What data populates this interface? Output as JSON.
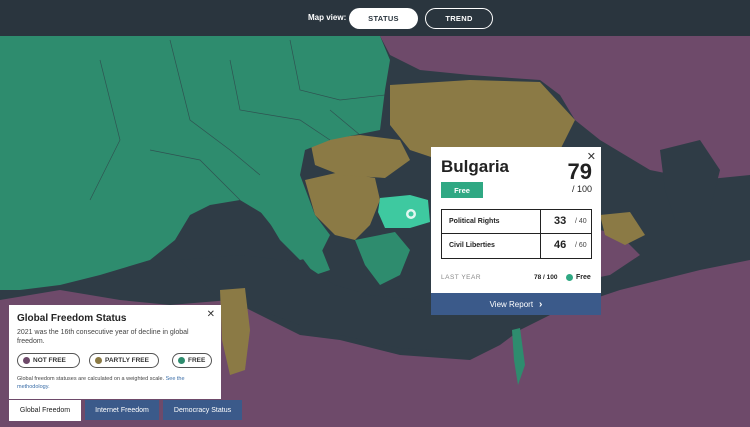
{
  "colors": {
    "free": "#2e8c6e",
    "free_highlight": "#3ec9a0",
    "partly_free": "#8b7a45",
    "not_free": "#6e4a6a",
    "water": "#2f3c46",
    "accent_blue": "#3b5a8a"
  },
  "topbar": {
    "map_view_label": "Map view:",
    "status_label": "STATUS",
    "trend_label": "TREND"
  },
  "country_card": {
    "name": "Bulgaria",
    "status": "Free",
    "score": "79",
    "score_max": "/ 100",
    "rows": [
      {
        "label": "Political Rights",
        "value": "33",
        "max": "/ 40"
      },
      {
        "label": "Civil Liberties",
        "value": "46",
        "max": "/ 60"
      }
    ],
    "last_year_label": "LAST YEAR",
    "last_year_score": "78 / 100",
    "last_year_status": "Free",
    "view_report_label": "View Report",
    "close_icon": "close-icon"
  },
  "legend": {
    "title": "Global Freedom Status",
    "description": "2021 was the 16th consecutive year of decline in global freedom.",
    "pills": [
      {
        "label": "NOT FREE",
        "color": "#6e4a6a"
      },
      {
        "label": "PARTLY FREE",
        "color": "#8b7a45"
      },
      {
        "label": "FREE",
        "color": "#2e8c6e"
      }
    ],
    "note": "Global freedom statuses are calculated on a weighted scale.",
    "note_link": "See the methodology."
  },
  "tabs": {
    "global_freedom": "Global Freedom",
    "internet_freedom": "Internet Freedom",
    "democracy_status": "Democracy Status"
  }
}
